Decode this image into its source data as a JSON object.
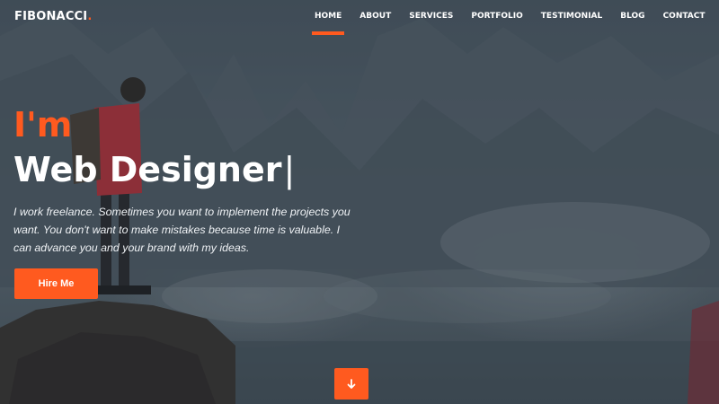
{
  "brand": {
    "logo_text": "FIBONACCI",
    "logo_dot": ".",
    "accent_color": "#ff5a1f"
  },
  "nav": {
    "items": [
      {
        "label": "HOME",
        "active": true
      },
      {
        "label": "ABOUT",
        "active": false
      },
      {
        "label": "SERVICES",
        "active": false
      },
      {
        "label": "PORTFOLIO",
        "active": false
      },
      {
        "label": "TESTIMONIAL",
        "active": false
      },
      {
        "label": "BLOG",
        "active": false
      },
      {
        "label": "CONTACT",
        "active": false
      }
    ]
  },
  "hero": {
    "intro": "I'm",
    "title": "Web Designer",
    "cursor": "|",
    "description": "I work freelance. Sometimes you want to implement the projects you want. You don't want to make mistakes because time is valuable. I can advance you and your brand with my ideas.",
    "cta_label": "Hire Me",
    "scroll_icon": "arrow-down-icon"
  }
}
